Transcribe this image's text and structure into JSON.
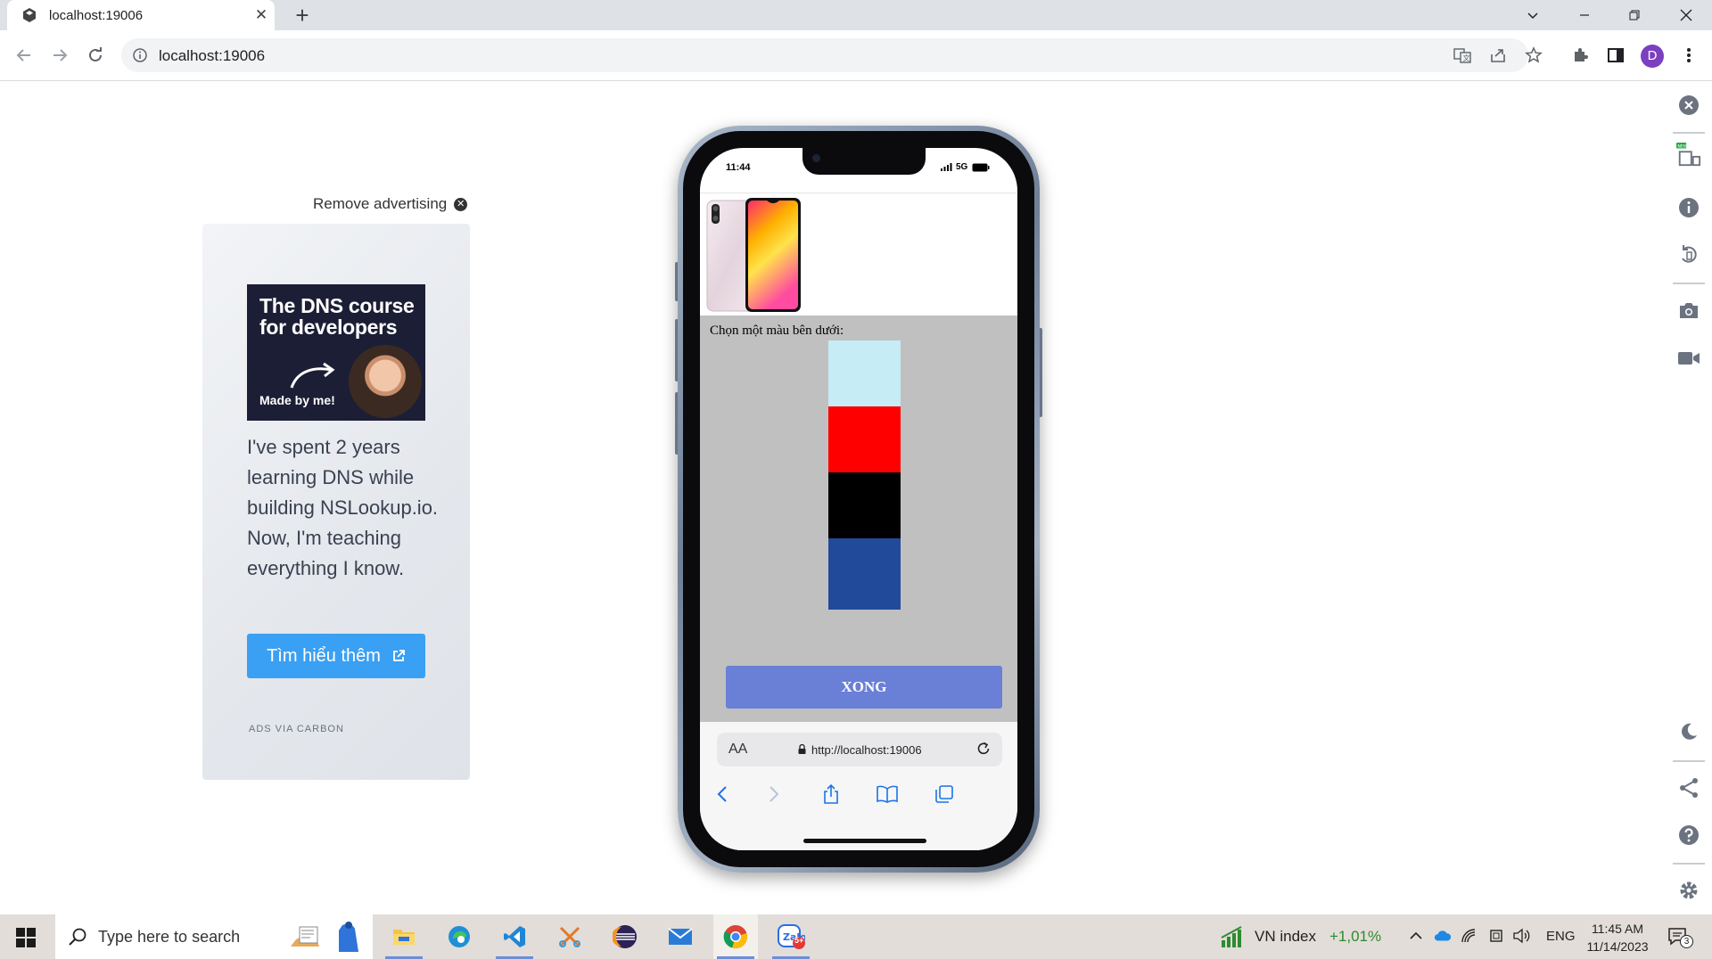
{
  "browser": {
    "tab_title": "localhost:19006",
    "url": "localhost:19006"
  },
  "ad": {
    "remove_label": "Remove advertising",
    "image_headline": "The DNS course for developers",
    "image_caption": "Made by me!",
    "body": "I've spent 2 years learning DNS while building NSLookup.io. Now, I'm teaching everything I know.",
    "button_label": "Tìm hiểu thêm",
    "footer": "ADS VIA CARBON"
  },
  "phone": {
    "status_time": "11:44",
    "network": "5G",
    "prompt": "Chọn một màu bên dưới:",
    "swatches": [
      {
        "name": "light-blue",
        "color": "#c6ecf6"
      },
      {
        "name": "red",
        "color": "#ff0000"
      },
      {
        "name": "black",
        "color": "#000000"
      },
      {
        "name": "navy-blue",
        "color": "#224a9a"
      }
    ],
    "done_label": "XONG",
    "safari": {
      "text_size_label": "AA",
      "url": "http://localhost:19006"
    }
  },
  "taskbar": {
    "search_placeholder": "Type here to search",
    "stock_label": "VN index",
    "stock_change": "+1,01%",
    "language": "ENG",
    "time": "11:45 AM",
    "date": "11/14/2023",
    "notification_count": "3",
    "zalo_badge": "5+"
  },
  "colors": {
    "accent_blue": "#3aa0f3",
    "done_button": "#6a7fd6",
    "stock_green": "#2e8b2e"
  }
}
